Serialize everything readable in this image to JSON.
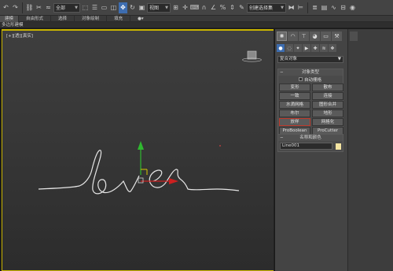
{
  "toolbar": {
    "filter_value": "全部",
    "refcoord_value": "视图",
    "selset_value": "创建选择集",
    "icons": [
      "undo-icon",
      "redo-icon",
      "link-icon",
      "unlink-icon",
      "bind-spacewarp-icon",
      "select-object-icon",
      "select-by-name-icon",
      "rect-select-icon",
      "window-crossing-icon",
      "move-icon",
      "rotate-icon",
      "scale-icon",
      "pivot-icon",
      "manipulate-icon",
      "keyboard-icon",
      "snap-3-icon",
      "angle-snap-icon",
      "percent-snap-icon",
      "spinner-snap-icon",
      "edit-named-sel-icon",
      "mirror-icon",
      "align-icon",
      "layer-icon",
      "graphite-icon",
      "curve-editor-icon",
      "schematic-icon",
      "material-icon",
      "render-setup-icon",
      "render-frame-icon",
      "render-icon"
    ]
  },
  "ribbon": {
    "tabs": [
      "建模",
      "自由形式",
      "选择",
      "对象绘制",
      "填充"
    ]
  },
  "subribbon": {
    "label": "多边形建模"
  },
  "viewport": {
    "label": "[+][透][真实]"
  },
  "command_panel": {
    "category": "复合对象",
    "object_type": {
      "title": "对象类型",
      "autogrid": "自动栅格",
      "buttons": [
        "变形",
        "散布",
        "一致",
        "连接",
        "水滴网格",
        "图形合并",
        "布尔",
        "地形",
        "放样",
        "网格化",
        "ProBoolean",
        "ProCutter"
      ],
      "selected_index": 8
    },
    "name_color": {
      "title": "名称和颜色",
      "name_value": "Line001",
      "swatch_color": "#f4e4a1"
    }
  },
  "colors": {
    "viewport_border": "#c9b400",
    "active_blue": "#3d6db0",
    "spline": "#e6e6e6"
  }
}
